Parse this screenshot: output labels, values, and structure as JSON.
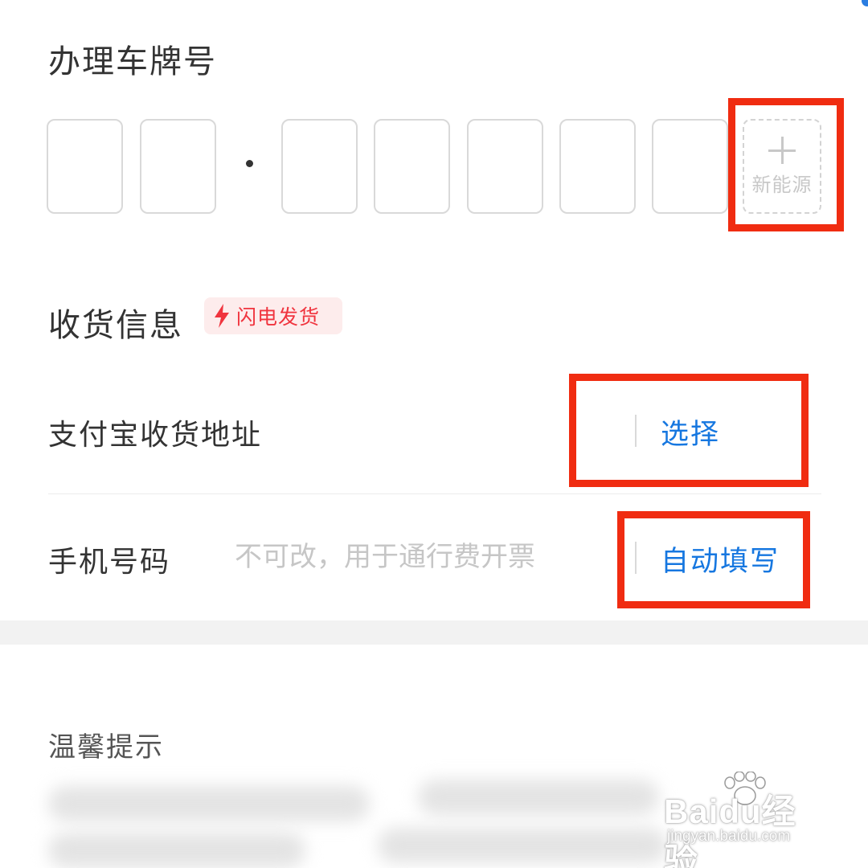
{
  "plate_section": {
    "title": "办理车牌号",
    "new_energy_label": "新能源"
  },
  "shipping_section": {
    "title": "收货信息",
    "badge_label": "闪电发货"
  },
  "address_row": {
    "label": "支付宝收货地址",
    "action": "选择"
  },
  "phone_row": {
    "label": "手机号码",
    "placeholder": "不可改，用于通行费开票",
    "action": "自动填写"
  },
  "tips": {
    "title": "温馨提示"
  },
  "watermark": {
    "brand": "Baidu经验",
    "url": "jingyan.baidu.com"
  },
  "colors": {
    "accent_blue": "#1677e0",
    "badge_red": "#f0343e",
    "highlight_red": "#f02c11"
  },
  "icons": [
    "plus-icon",
    "lightning-icon",
    "baidu-paw-icon"
  ]
}
